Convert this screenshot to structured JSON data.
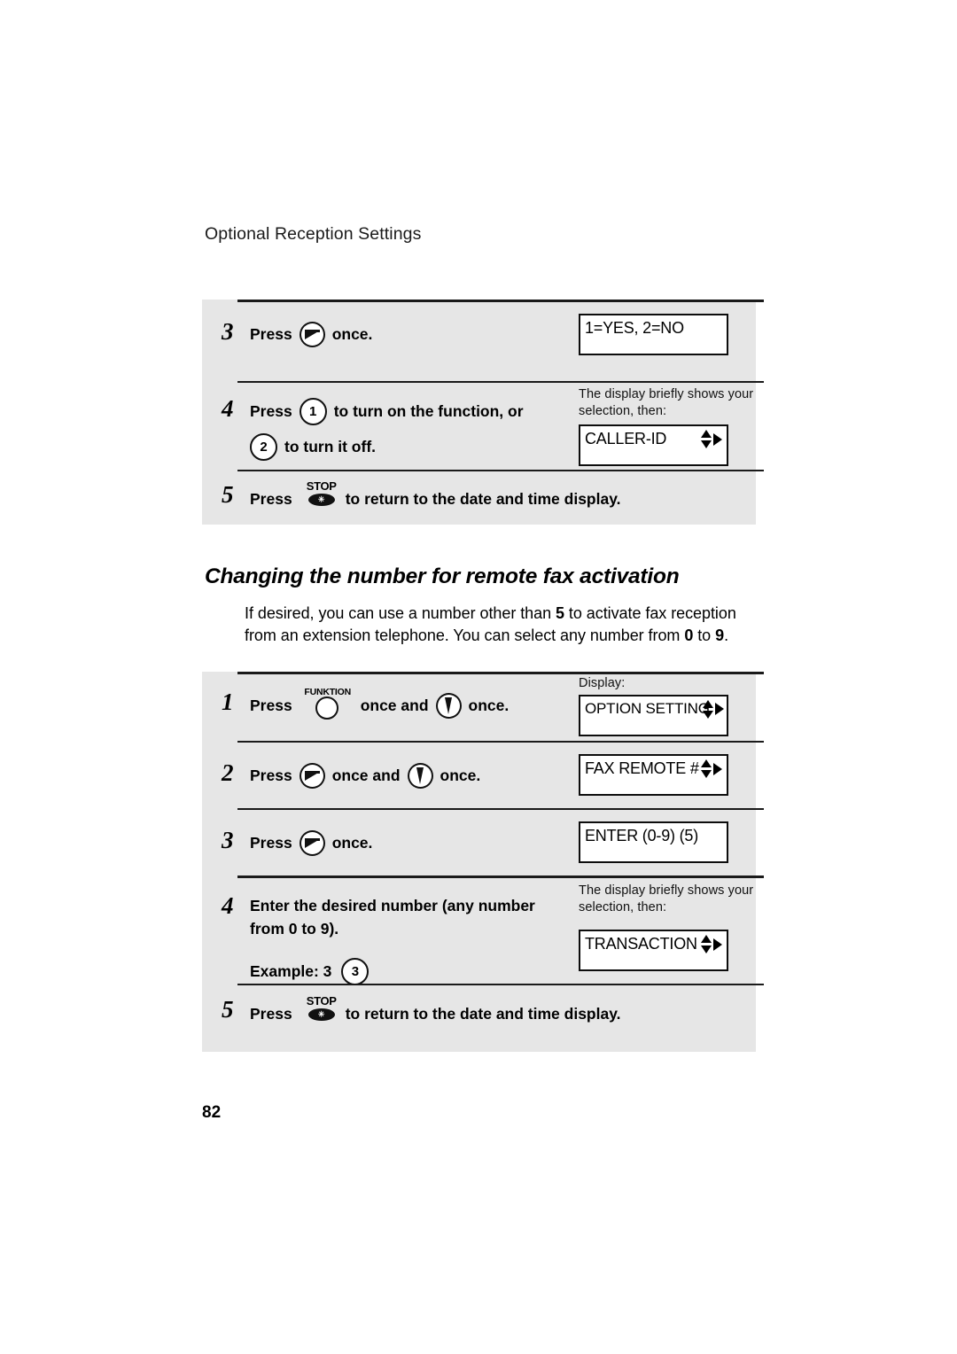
{
  "page": {
    "running_header": "Optional Reception Settings",
    "folio": "82"
  },
  "section": {
    "heading": "Changing the number for remote fax activation",
    "paragraph": {
      "part1": "If desired, you can use a number other than ",
      "bold1": "5",
      "part2": " to activate fax reception from an extension telephone. You can select any number from ",
      "bold2": "0",
      "part3": " to ",
      "bold3": "9",
      "part4": "."
    }
  },
  "block1": {
    "steps": [
      {
        "number": "3",
        "line1_pre": "Press",
        "icon": "start-key-icon",
        "line1_post": "once.",
        "display": {
          "note": "",
          "lcd_text": "1=YES, 2=NO",
          "arrows": "none"
        }
      },
      {
        "number": "4",
        "line1_pre": "Press",
        "key1": "1",
        "line1_post": "to turn on the function, or",
        "key2": "2",
        "line2_post": "to turn it off.",
        "display": {
          "note": "The display briefly shows your selection, then:",
          "lcd_text": "CALLER-ID",
          "arrows": "updown-right"
        }
      },
      {
        "number": "5",
        "line1_pre": "Press",
        "icon": "stop-key-icon",
        "icon_label": "STOP",
        "line1_post": "to return to the date and time display."
      }
    ]
  },
  "block2": {
    "steps": [
      {
        "number": "1",
        "line1_pre": "Press",
        "icon1": "funktion-key-icon",
        "icon1_label": "FUNKTION",
        "line1_mid": "once and",
        "icon2": "down-key-icon",
        "line1_post": "once.",
        "display": {
          "note": "Display:",
          "lcd_text": "OPTION SETTING",
          "arrows": "updown-right"
        }
      },
      {
        "number": "2",
        "line1_pre": "Press",
        "icon1": "start-key-icon",
        "line1_mid": "once and",
        "icon2": "down-key-icon",
        "line1_post": "once.",
        "display": {
          "note": "",
          "lcd_text": "FAX REMOTE #",
          "arrows": "updown-right"
        }
      },
      {
        "number": "3",
        "line1_pre": "Press",
        "icon1": "start-key-icon",
        "line1_post": "once.",
        "display": {
          "note": "",
          "lcd_text": "ENTER (0-9) (5)",
          "arrows": "none"
        }
      },
      {
        "number": "4",
        "line1": "Enter the desired number (any number",
        "line2": "from 0 to 9).",
        "line3_pre": "Example: 3",
        "key": "3",
        "display": {
          "note": "The display briefly shows your selection, then:",
          "lcd_text": "TRANSACTION",
          "arrows": "updown-right"
        }
      },
      {
        "number": "5",
        "line1_pre": "Press",
        "icon": "stop-key-icon",
        "icon_label": "STOP",
        "line1_post": "to return to the date and time display."
      }
    ]
  },
  "colors": {
    "block_bg": "#e6e6e6",
    "rule": "#1a1a1a",
    "ink": "#000000"
  }
}
